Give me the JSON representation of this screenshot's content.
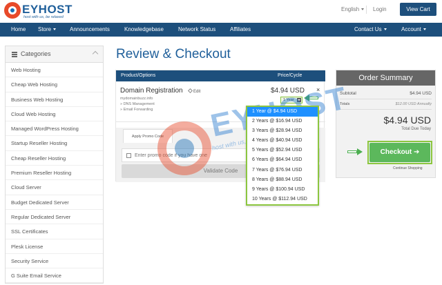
{
  "brand": {
    "name": "EYHOST",
    "tagline": "host with us, be relaxed"
  },
  "header": {
    "language": "English",
    "login": "Login",
    "view_cart": "View Cart"
  },
  "nav": {
    "items": [
      "Home",
      "Store",
      "Announcements",
      "Knowledgebase",
      "Network Status",
      "Affiliates"
    ],
    "right": [
      "Contact Us",
      "Account"
    ]
  },
  "sidebar": {
    "title": "Categories",
    "items": [
      "Web Hosting",
      "Cheap Web Hosting",
      "Business Web Hosting",
      "Cloud Web Hosting",
      "Managed WordPress Hosting",
      "Startup Reseller Hosting",
      "Cheap Reseller Hosting",
      "Premium Reseller Hosting",
      "Cloud Server",
      "Budget Dedicated Server",
      "Regular Dedicated Server",
      "SSL Certificates",
      "Plesk License",
      "Security Service",
      "G Suite Email Service"
    ]
  },
  "main": {
    "title": "Review & Checkout",
    "cart": {
      "col_product": "Product/Options",
      "col_price": "Price/Cycle",
      "product_name": "Domain Registration",
      "edit": "Edit",
      "domain": "mydomainbuzz.info",
      "feature1": "» DNS Management",
      "feature2": "» Email Forwarding",
      "price": "$4.94 USD",
      "remove": "×",
      "cycle_selected": "1 Year"
    },
    "cycle_options": [
      "1 Year @ $4.94 USD",
      "2 Years @ $16.94 USD",
      "3 Years @ $28.94 USD",
      "4 Years @ $40.94 USD",
      "5 Years @ $52.94 USD",
      "6 Years @ $64.94 USD",
      "7 Years @ $76.94 USD",
      "8 Years @ $88.94 USD",
      "9 Years @ $100.94 USD",
      "10 Years @ $112.94 USD"
    ],
    "promo": {
      "tab": "Apply Promo Code",
      "placeholder": "Enter promo code if you have one",
      "validate": "Validate Code"
    }
  },
  "summary": {
    "title": "Order Summary",
    "subtotal_label": "Subtotal",
    "subtotal_value": "$4.94 USD",
    "totals_label": "Totals",
    "totals_value": "$12.00 USD Annually",
    "total": "$4.94 USD",
    "due_label": "Total Due Today",
    "checkout": "Checkout ➔",
    "continue": "Continue Shopping"
  },
  "watermark": {
    "text": "EYHOST",
    "tagline": "host with us, be relaxed"
  },
  "colors": {
    "brand_blue": "#1d4f7c",
    "accent_green": "#5cb85c",
    "highlight_green": "#8cc63f",
    "brand_red": "#e84a2a"
  }
}
